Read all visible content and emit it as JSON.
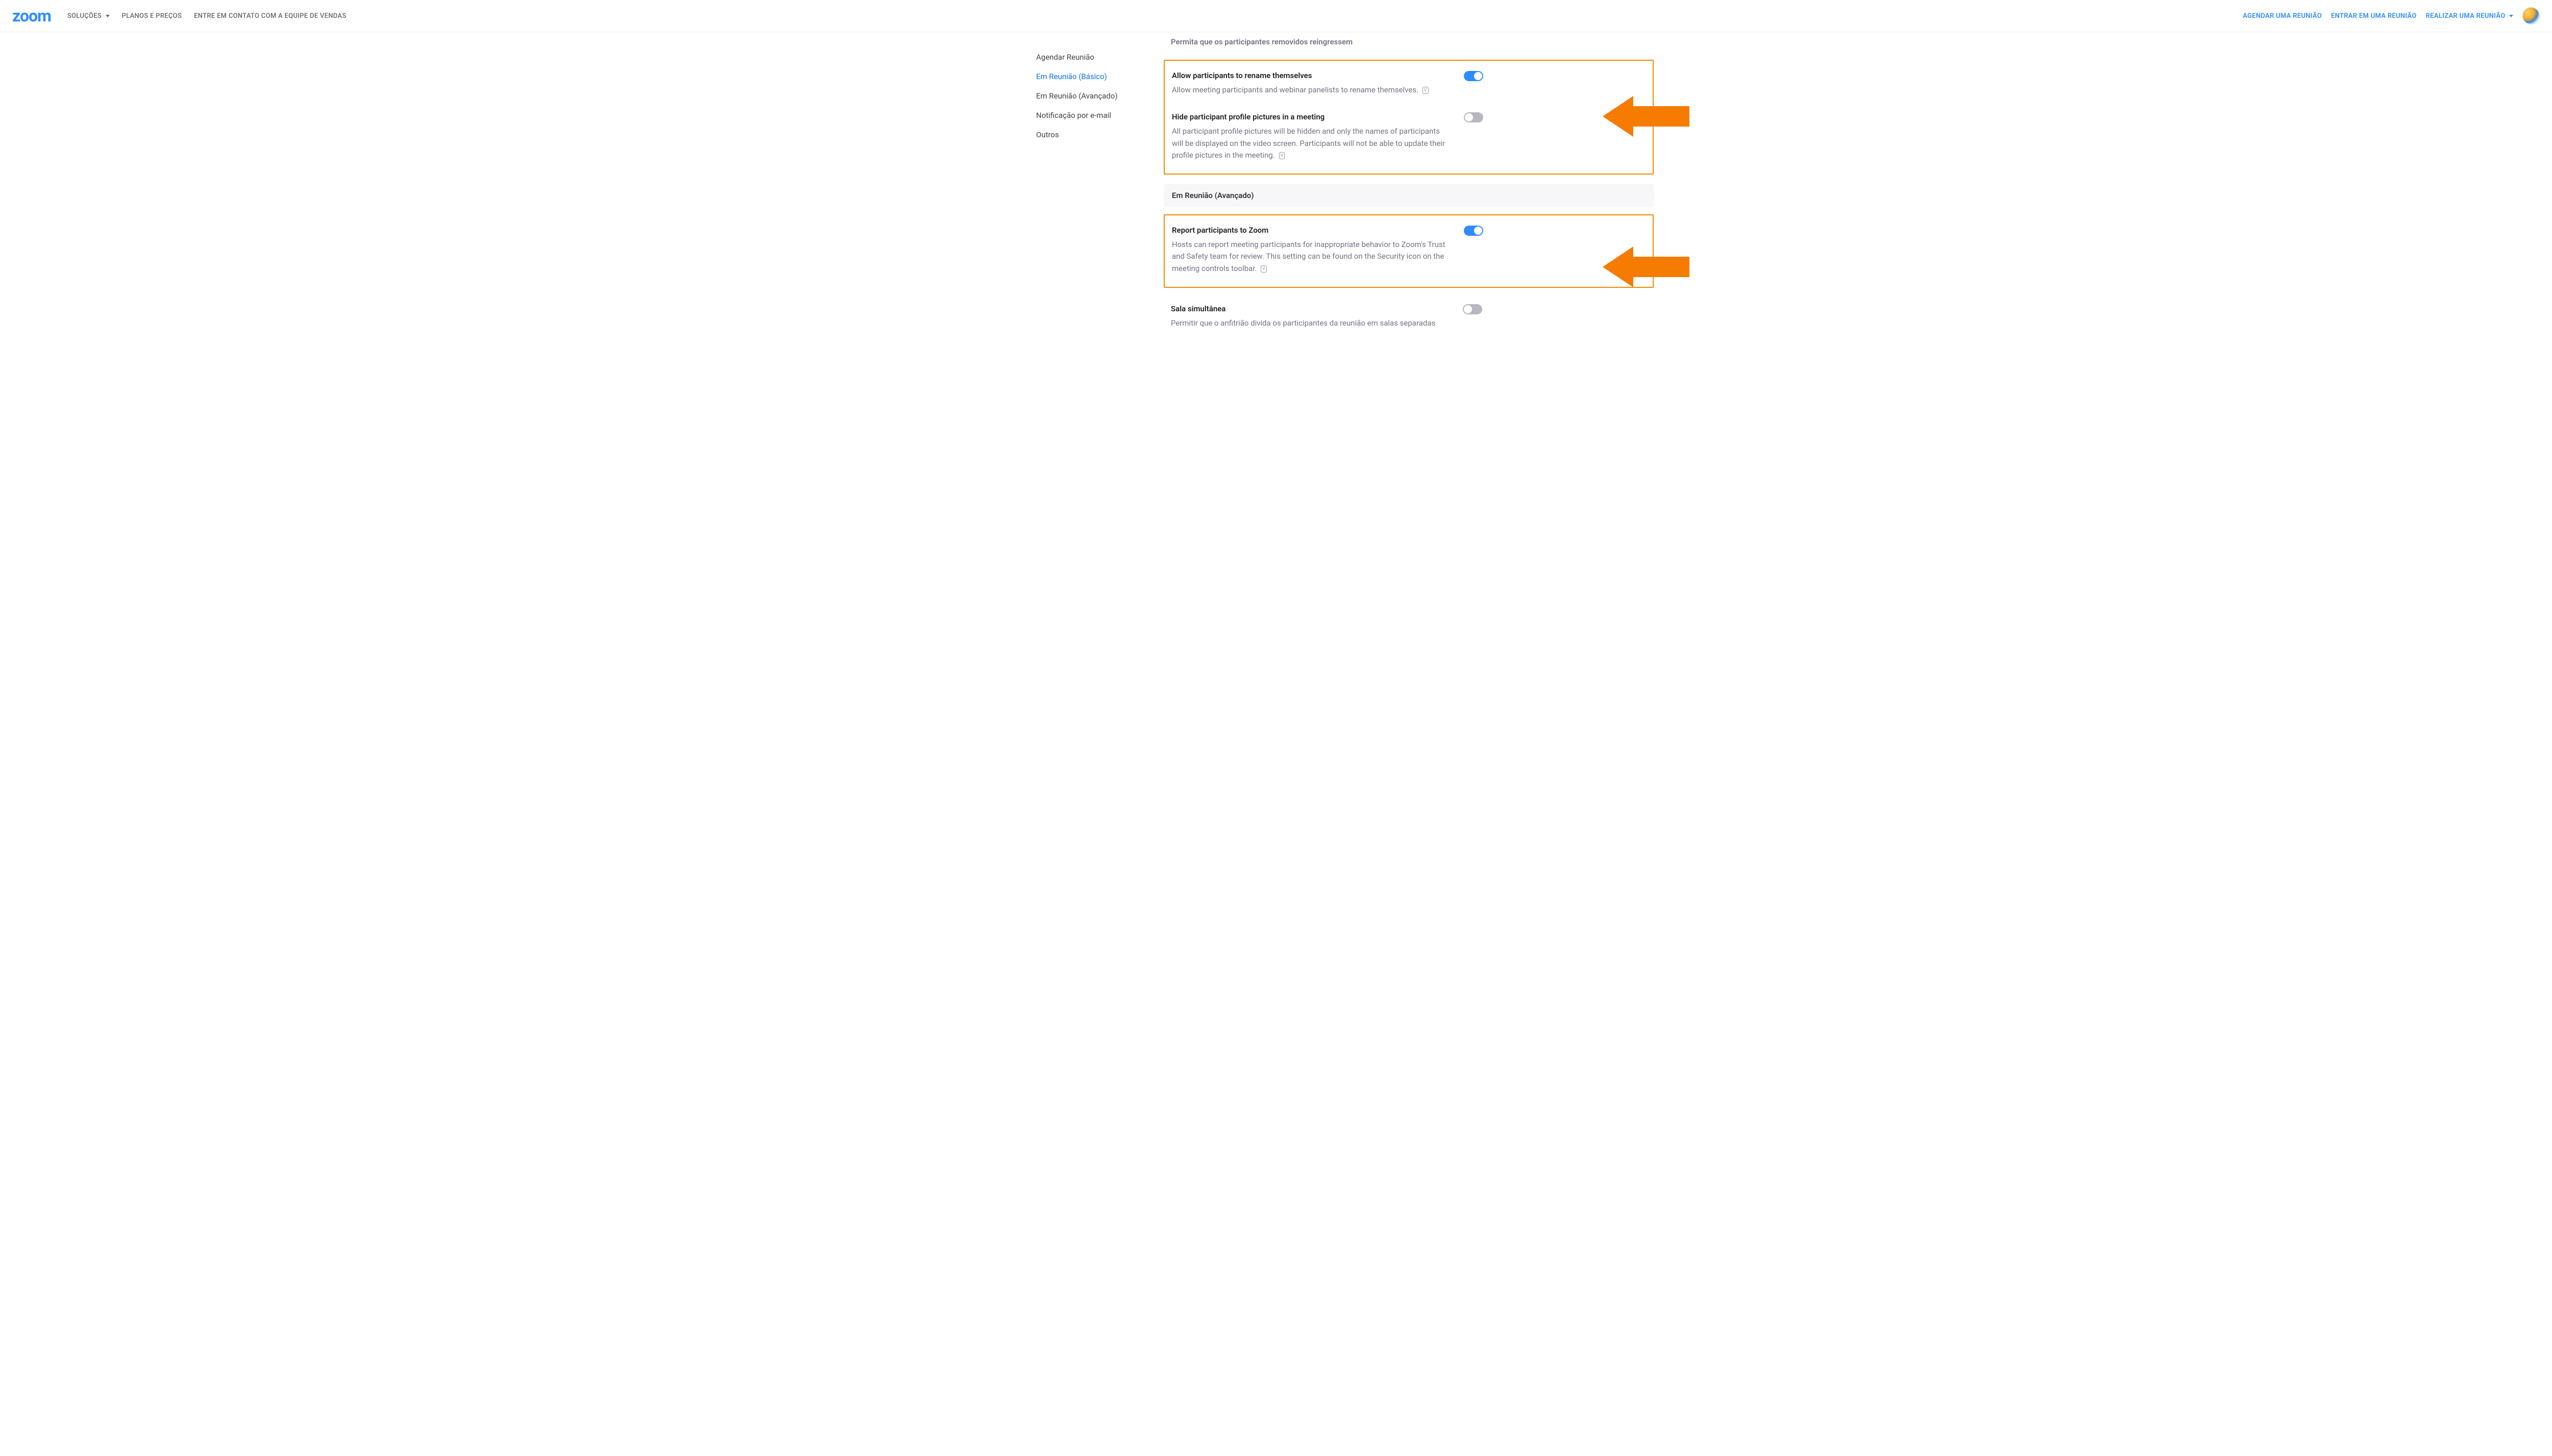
{
  "brand": "zoom",
  "nav": {
    "solutions": "SOLUÇÕES",
    "plans": "PLANOS E PREÇOS",
    "sales": "ENTRE EM CONTATO COM A EQUIPE DE VENDAS",
    "schedule": "AGENDAR UMA REUNIÃO",
    "join": "ENTRAR EM UMA REUNIÃO",
    "host": "REALIZAR UMA REUNIÃO"
  },
  "sidebar": {
    "schedule": "Agendar Reunião",
    "basic": "Em Reunião (Básico)",
    "advanced": "Em Reunião (Avançado)",
    "email": "Notificação por e-mail",
    "others": "Outros"
  },
  "faded": {
    "title": "Permita que os participantes removidos reingressem"
  },
  "settings": {
    "rename": {
      "title": "Allow participants to rename themselves",
      "desc": "Allow meeting participants and webinar panelists to rename themselves.",
      "on": true
    },
    "hide_pics": {
      "title": "Hide participant profile pictures in a meeting",
      "desc": "All participant profile pictures will be hidden and only the names of participants will be displayed on the video screen. Participants will not be able to update their profile pictures in the meeting.",
      "on": false
    },
    "section_advanced": "Em Reunião (Avançado)",
    "report": {
      "title": "Report participants to Zoom",
      "desc": "Hosts can report meeting participants for inappropriate behavior to Zoom's Trust and Safety team for review. This setting can be found on the Security icon on the meeting controls toolbar.",
      "on": true
    },
    "breakout": {
      "title": "Sala simultânea",
      "desc": "Permitir que o anfitrião divida os participantes da reunião em salas separadas",
      "on": false
    }
  }
}
